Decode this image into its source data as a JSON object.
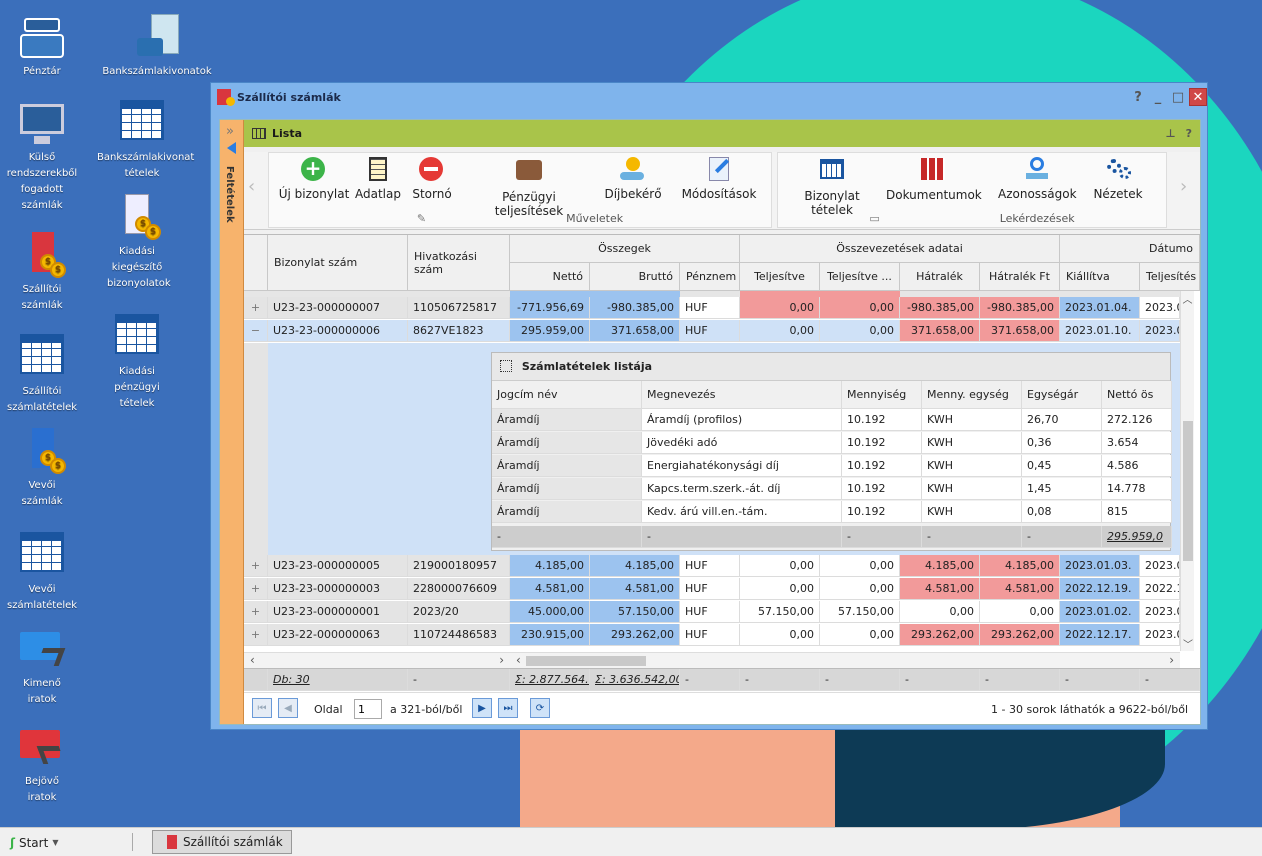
{
  "desktop": {
    "icons": [
      {
        "label": "Pénztár"
      },
      {
        "label": "Bankszámlakivonatok"
      },
      {
        "label": "Külső rendszerekből fogadott számlák"
      },
      {
        "label": "Bankszámlakivonat tételek"
      },
      {
        "label": "Szállítói számlák"
      },
      {
        "label": "Kiadási kiegészítő bizonyolatok"
      },
      {
        "label": "Szállítói számlatételek"
      },
      {
        "label": "Kiadási pénzügyi tételek"
      },
      {
        "label": "Vevői számlák"
      },
      {
        "label": "Vevői számlatételek"
      },
      {
        "label": "Kimenő iratok"
      },
      {
        "label": "Bejövő iratok"
      }
    ]
  },
  "window": {
    "title": "Szállítói számlák",
    "help": "?",
    "minimize": "_",
    "maximize": "□",
    "close": "✕"
  },
  "sidebar": {
    "label": "Feltételek"
  },
  "panel": {
    "title": "Lista"
  },
  "ribbon": {
    "group1": {
      "label": "Műveletek",
      "buttons": [
        "Új bizonylat",
        "Adatlap",
        "Stornó",
        "Pénzügyi teljesítések",
        "Díjbekérő",
        "Módosítások"
      ]
    },
    "group2": {
      "label": "Lekérdezések",
      "buttons": [
        "Bizonylat tételek",
        "Dokumentumok",
        "Azonosságok",
        "Nézetek"
      ]
    }
  },
  "grid": {
    "group_headers": {
      "osszegek": "Összegek",
      "osszevezetes": "Összevezetések adatai",
      "datumok": "Dátumo"
    },
    "columns": [
      "Bizonylat szám",
      "Hivatkozási szám",
      "Nettó",
      "Bruttó",
      "Pénznem",
      "Teljesítve",
      "Teljesítve ...",
      "Hátralék",
      "Hátralék Ft",
      "Kiállítva",
      "Teljesítés"
    ],
    "rows": [
      {
        "exp": "+",
        "bizonylat": "U23-23-000000007",
        "hivatkozas": "110506725817",
        "netto": "-771.956,69",
        "brutto": "-980.385,00",
        "penznem": "HUF",
        "telj": "0,00",
        "telj2": "0,00",
        "hatralek": "-980.385,00",
        "hatralekft": "-980.385,00",
        "kiallitva": "2023.01.04.",
        "teljesites": "2023.0"
      },
      {
        "exp": "−",
        "bizonylat": "U23-23-000000006",
        "hivatkozas": "8627VE1823",
        "netto": "295.959,00",
        "brutto": "371.658,00",
        "penznem": "HUF",
        "telj": "0,00",
        "telj2": "0,00",
        "hatralek": "371.658,00",
        "hatralekft": "371.658,00",
        "kiallitva": "2023.01.10.",
        "teljesites": "2023.0"
      },
      {
        "exp": "+",
        "bizonylat": "U23-23-000000005",
        "hivatkozas": "219000180957",
        "netto": "4.185,00",
        "brutto": "4.185,00",
        "penznem": "HUF",
        "telj": "0,00",
        "telj2": "0,00",
        "hatralek": "4.185,00",
        "hatralekft": "4.185,00",
        "kiallitva": "2023.01.03.",
        "teljesites": "2023.0"
      },
      {
        "exp": "+",
        "bizonylat": "U23-23-000000003",
        "hivatkozas": "228000076609",
        "netto": "4.581,00",
        "brutto": "4.581,00",
        "penznem": "HUF",
        "telj": "0,00",
        "telj2": "0,00",
        "hatralek": "4.581,00",
        "hatralekft": "4.581,00",
        "kiallitva": "2022.12.19.",
        "teljesites": "2022.1"
      },
      {
        "exp": "+",
        "bizonylat": "U23-23-000000001",
        "hivatkozas": "2023/20",
        "netto": "45.000,00",
        "brutto": "57.150,00",
        "penznem": "HUF",
        "telj": "57.150,00",
        "telj2": "57.150,00",
        "hatralek": "0,00",
        "hatralekft": "0,00",
        "kiallitva": "2023.01.02.",
        "teljesites": "2023.0"
      },
      {
        "exp": "+",
        "bizonylat": "U23-22-000000063",
        "hivatkozas": "110724486583",
        "netto": "230.915,00",
        "brutto": "293.262,00",
        "penznem": "HUF",
        "telj": "0,00",
        "telj2": "0,00",
        "hatralek": "293.262,00",
        "hatralekft": "293.262,00",
        "kiallitva": "2022.12.17.",
        "teljesites": "2023.0"
      }
    ],
    "footer": {
      "count": "Db: 30",
      "dash": "-",
      "netto_sum": "Σ: 2.877.564...",
      "brutto_sum": "Σ: 3.636.542,00"
    }
  },
  "detail": {
    "title": "Számlatételek listája",
    "columns": [
      "Jogcím név",
      "Megnevezés",
      "Mennyiség",
      "Menny. egység",
      "Egységár",
      "Nettó ös"
    ],
    "rows": [
      [
        "Áramdíj",
        "Áramdíj (profilos)",
        "10.192",
        "KWH",
        "26,70",
        "272.126"
      ],
      [
        "Áramdíj",
        "Jövedéki adó",
        "10.192",
        "KWH",
        "0,36",
        "3.654"
      ],
      [
        "Áramdíj",
        "Energiahatékonysági díj",
        "10.192",
        "KWH",
        "0,45",
        "4.586"
      ],
      [
        "Áramdíj",
        "Kapcs.term.szerk.-át. díj",
        "10.192",
        "KWH",
        "1,45",
        "14.778"
      ],
      [
        "Áramdíj",
        "Kedv. árú vill.en.-tám.",
        "10.192",
        "KWH",
        "0,08",
        "815"
      ]
    ],
    "footer": [
      "-",
      "-",
      "-",
      "-",
      "-",
      "295.959,0"
    ]
  },
  "pager": {
    "label": "Oldal",
    "page": "1",
    "of": "a 321-ból/ből",
    "status": "1 - 30 sorok láthatók a 9622-ból/ből"
  },
  "taskbar": {
    "start": "Start",
    "task": "Szállítói számlák"
  },
  "colors": {
    "desktop": "#3b6fbb",
    "teal": "#1bd6bf",
    "salmon": "#f4a98a",
    "navy": "#0d3a55",
    "accent": "#a9c44a",
    "sidebar": "#f7b36c"
  }
}
